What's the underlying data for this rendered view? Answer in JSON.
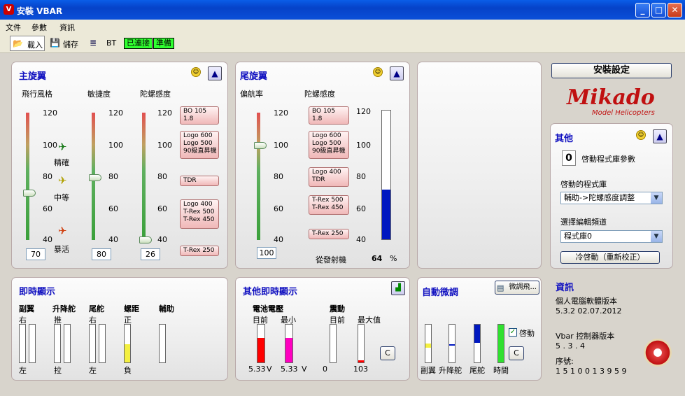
{
  "window": {
    "title": "安裝 VBAR",
    "min": "_",
    "max": "□",
    "close": "✕"
  },
  "menu": [
    "文件",
    "參數",
    "資訊"
  ],
  "toolbar": {
    "load": "載入",
    "save": "儲存",
    "bt": "BT",
    "status1": "已連接",
    "status2": "準備"
  },
  "main_rotor": {
    "title": "主旋翼",
    "col1": "飛行風格",
    "col2": "敏捷度",
    "col3": "陀螺感度",
    "ticks": [
      "120",
      "100",
      "80",
      "60",
      "40"
    ],
    "style_labels": [
      "精確",
      "中等",
      "暴活"
    ],
    "values": {
      "style": "70",
      "agility": "80",
      "gyro": "26"
    },
    "presets": [
      "BO 105 1.8",
      "Logo 600\nLogo 500\n90級直昇機",
      "TDR",
      "Logo 400\nT-Rex 500\nT-Rex 450",
      "T-Rex 250"
    ]
  },
  "tail_rotor": {
    "title": "尾旋翼",
    "col1": "偏航率",
    "col2": "陀螺感度",
    "ticks": [
      "120",
      "100",
      "80",
      "60",
      "40"
    ],
    "value": "100",
    "presets": [
      "BO 105 1.8",
      "Logo 600\nLogo 500\n90級直昇機",
      "Logo 400\nTDR",
      "T-Rex 500\nT-Rex 450",
      "T-Rex 250"
    ],
    "tx_label": "從發射機",
    "tx_value": "64",
    "tx_unit": "%",
    "tx_percent": 64
  },
  "right": {
    "setup_button": "安裝設定",
    "logo_text": "Mikado",
    "logo_sub": "Model Helicopters",
    "other_title": "其他",
    "startup_num": "0",
    "startup_label": "啓動程式庫參數",
    "boot_lib_label": "啓動的程式庫",
    "boot_lib_value": "輔助->陀螺感度調整",
    "edit_bank_label": "選擇編輯頻道",
    "edit_bank_value": "程式庫0",
    "cold_start": "冷啓動（重新校正）"
  },
  "realtime": {
    "title": "即時顯示",
    "cols": [
      {
        "name": "副翼",
        "top": "右",
        "bottom": "左"
      },
      {
        "name": "升降舵",
        "top": "推",
        "bottom": "拉"
      },
      {
        "name": "尾舵",
        "top": "右",
        "bottom": "左"
      },
      {
        "name": "螺距",
        "top": "正",
        "bottom": "負"
      },
      {
        "name": "輔助",
        "top": "",
        "bottom": ""
      }
    ]
  },
  "other_rt": {
    "title": "其他即時顯示",
    "battery": "電池電壓",
    "current": "目前",
    "min": "最小",
    "v_current": "5.33",
    "v_min": "5.33",
    "unit": "V",
    "vibration": "震動",
    "vib_current": "目前",
    "vib_max": "最大值",
    "vib_val": "0",
    "vib_maxval": "103",
    "clear": "C"
  },
  "auto_trim": {
    "title": "自動微調",
    "fine_button": "微調飛...",
    "labels": [
      "副翼",
      "升降舵",
      "尾舵",
      "時間"
    ],
    "enable": "啓動",
    "clear": "C"
  },
  "info": {
    "title": "資訊",
    "pc_label": "個人電腦軟體版本",
    "pc_version": "5.3.2  02.07.2012",
    "vbar_label": "Vbar 控制器版本",
    "vbar_version": "5 . 3 . 4",
    "serial_label": "序號:",
    "serial": "1 5 1 0 0 1 3 9 5 9"
  },
  "colors": {
    "accent": "#1010c0",
    "status_green": "#30ff30",
    "battery_red": "#ff0000",
    "battery_magenta": "#ff00c0"
  }
}
